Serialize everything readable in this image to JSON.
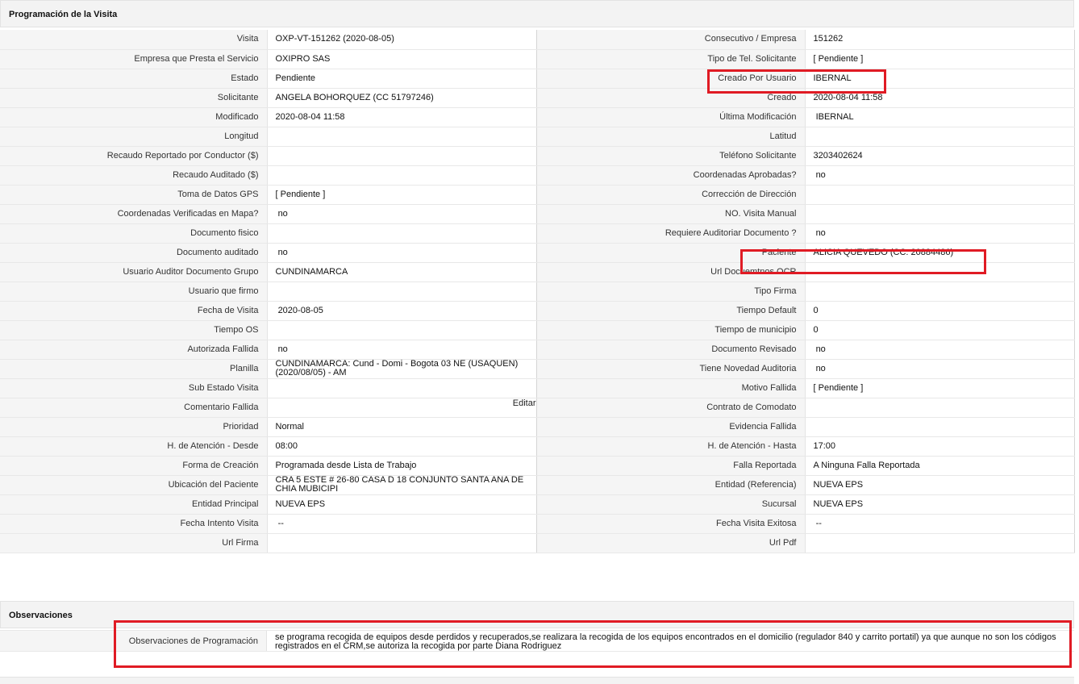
{
  "sections": {
    "programacion_title": "Programación de la Visita",
    "observaciones_title": "Observaciones"
  },
  "rows": [
    {
      "l1": "Visita",
      "v1": "OXP-VT-151262 (2020-08-05)",
      "l2": "Consecutivo / Empresa",
      "v2": "151262"
    },
    {
      "l1": "Empresa que Presta el Servicio",
      "v1": "OXIPRO SAS",
      "l2": "Tipo de Tel. Solicitante",
      "v2": "[ Pendiente ]"
    },
    {
      "l1": "Estado",
      "v1": "Pendiente",
      "l2": "Creado Por Usuario",
      "v2": "IBERNAL"
    },
    {
      "l1": "Solicitante",
      "v1": "ANGELA BOHORQUEZ (CC 51797246)",
      "l2": "Creado",
      "v2": "2020-08-04 11:58"
    },
    {
      "l1": "Modificado",
      "v1": "2020-08-04 11:58",
      "l2": "Última Modificación",
      "v2": " IBERNAL"
    },
    {
      "l1": "Longitud",
      "v1": "",
      "l2": "Latitud",
      "v2": ""
    },
    {
      "l1": "Recaudo Reportado por Conductor ($)",
      "v1": "",
      "l2": "Teléfono Solicitante",
      "v2": "3203402624"
    },
    {
      "l1": "Recaudo Auditado ($)",
      "v1": "",
      "l2": "Coordenadas Aprobadas?",
      "v2": " no"
    },
    {
      "l1": "Toma de Datos GPS",
      "v1": "[ Pendiente ]",
      "l2": "Corrección de Dirección",
      "v2": ""
    },
    {
      "l1": "Coordenadas Verificadas en Mapa?",
      "v1": " no",
      "l2": "NO. Visita Manual",
      "v2": ""
    },
    {
      "l1": "Documento fisico",
      "v1": "",
      "l2": "Requiere Auditoriar Documento ?",
      "v2": " no"
    },
    {
      "l1": "Documento auditado",
      "v1": " no",
      "l2": "Paciente",
      "v2": "ALICIA QUEVEDO (CC: 20884486)"
    },
    {
      "l1": "Usuario Auditor Documento Grupo",
      "v1": "CUNDINAMARCA",
      "l2": "Url Docuemtnos OCR",
      "v2": ""
    },
    {
      "l1": "Usuario que firmo",
      "v1": "",
      "l2": "Tipo Firma",
      "v2": ""
    },
    {
      "l1": "Fecha de Visita",
      "v1": " 2020-08-05",
      "l2": "Tiempo Default",
      "v2": "0"
    },
    {
      "l1": "Tiempo OS",
      "v1": "",
      "l2": "Tiempo de municipio",
      "v2": "0"
    },
    {
      "l1": "Autorizada Fallida",
      "v1": " no",
      "l2": "Documento Revisado",
      "v2": " no"
    },
    {
      "l1": "Planilla",
      "v1": "CUNDINAMARCA: Cund - Domi - Bogota 03 NE (USAQUEN) (2020/08/05) - AM",
      "l2": "Tiene Novedad Auditoria",
      "v2": " no"
    },
    {
      "l1": "Sub Estado Visita",
      "v1": "",
      "l2": "Motivo Fallida",
      "v2": "[ Pendiente ]"
    },
    {
      "l1": "Comentario Fallida",
      "v1": "",
      "l2": "Contrato de Comodato",
      "v2": ""
    },
    {
      "l1": "Prioridad",
      "v1": "Normal",
      "l2": "Evidencia Fallida",
      "v2": ""
    },
    {
      "l1": "H. de Atención - Desde",
      "v1": "08:00",
      "l2": "H. de Atención - Hasta",
      "v2": "17:00"
    },
    {
      "l1": "Forma de Creación",
      "v1": "Programada desde Lista de Trabajo",
      "l2": "Falla Reportada",
      "v2": "A Ninguna Falla Reportada"
    },
    {
      "l1": "Ubicación del Paciente",
      "v1": "CRA 5 ESTE # 26-80 CASA D 18 CONJUNTO SANTA ANA DE CHIA MUBICIPI",
      "l2": "Entidad (Referencia)",
      "v2": "NUEVA EPS"
    },
    {
      "l1": "Entidad Principal",
      "v1": "NUEVA EPS",
      "l2": "Sucursal",
      "v2": "NUEVA EPS"
    },
    {
      "l1": "Fecha Intento Visita",
      "v1": " --",
      "l2": "Fecha Visita Exitosa",
      "v2": " --"
    },
    {
      "l1": "Url Firma",
      "v1": "",
      "l2": "Url Pdf",
      "v2": ""
    }
  ],
  "comentario_fallida": {
    "edit_label": "Editar"
  },
  "observaciones": {
    "label": "Observaciones de Programación",
    "value": "  se programa recogida de equipos desde perdidos y recuperados,se realizara la recogida de los equipos encontrados en el domicilio (regulador 840 y carrito portatil) ya que aunque no son los códigos registrados en el CRM,se autoriza la recogida por parte Diana Rodriguez"
  },
  "colors": {
    "highlight": "#e01b24",
    "label_bg": "#f5f5f5",
    "header_bg": "#f3f3f3"
  }
}
